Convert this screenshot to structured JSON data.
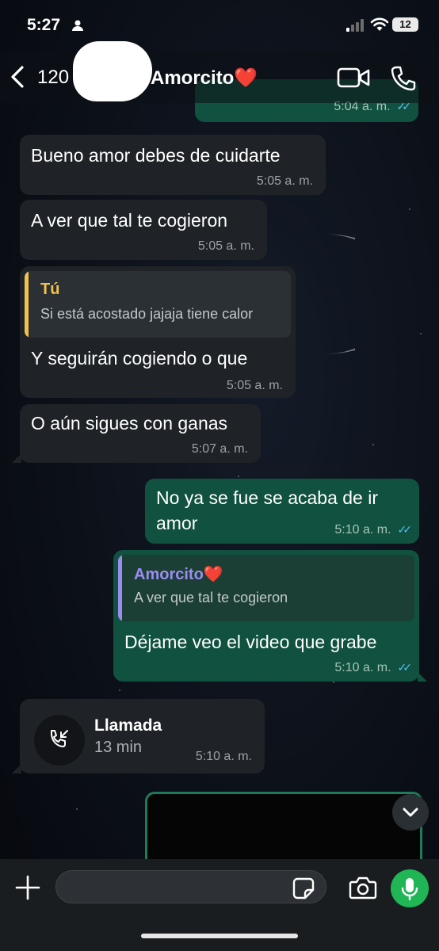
{
  "status_bar": {
    "time": "5:27",
    "battery": "12"
  },
  "header": {
    "contact_prefix": "120",
    "contact_name": "Amorcito❤️"
  },
  "messages": [
    {
      "type": "outgoing",
      "time": "5:04 a. m.",
      "ticks": "✓✓"
    },
    {
      "type": "incoming",
      "text": "Bueno amor debes de cuidarte",
      "time": "5:05 a. m."
    },
    {
      "type": "incoming",
      "text": "A ver que tal te cogieron",
      "time": "5:05 a. m."
    },
    {
      "type": "incoming",
      "quote_author": "Tú",
      "quote_text": "Si está acostado jajaja tiene calor",
      "text": "Y seguirán cogiendo o que",
      "time": "5:05 a. m."
    },
    {
      "type": "incoming",
      "text": "O aún sigues con ganas",
      "time": "5:07 a. m."
    },
    {
      "type": "outgoing",
      "text_line1": "No ya se fue se acaba de ir",
      "text_line2": "amor",
      "time": "5:10 a. m.",
      "ticks": "✓✓"
    },
    {
      "type": "outgoing",
      "quote_author": "Amorcito❤️",
      "quote_text": "A ver que tal te cogieron",
      "text": "Déjame veo el video que grabe",
      "time": "5:10 a. m.",
      "ticks": "✓✓"
    },
    {
      "type": "call",
      "title": "Llamada",
      "duration": "13 min",
      "time": "5:10 a. m."
    }
  ],
  "composer": {
    "placeholder": ""
  },
  "colors": {
    "incoming_bubble": "#1f2327",
    "outgoing_bubble": "#10513f",
    "read_ticks": "#53bdeb",
    "quote_bar_you": "#f2c14e",
    "quote_bar_contact": "#9b8cf2",
    "mic_button": "#20b656"
  },
  "icons": [
    "person-icon",
    "signal-icon",
    "wifi-icon",
    "battery-icon",
    "back-chevron-icon",
    "video-call-icon",
    "phone-icon",
    "incoming-call-icon",
    "chevron-down-icon",
    "plus-icon",
    "sticker-icon",
    "camera-icon",
    "microphone-icon"
  ]
}
